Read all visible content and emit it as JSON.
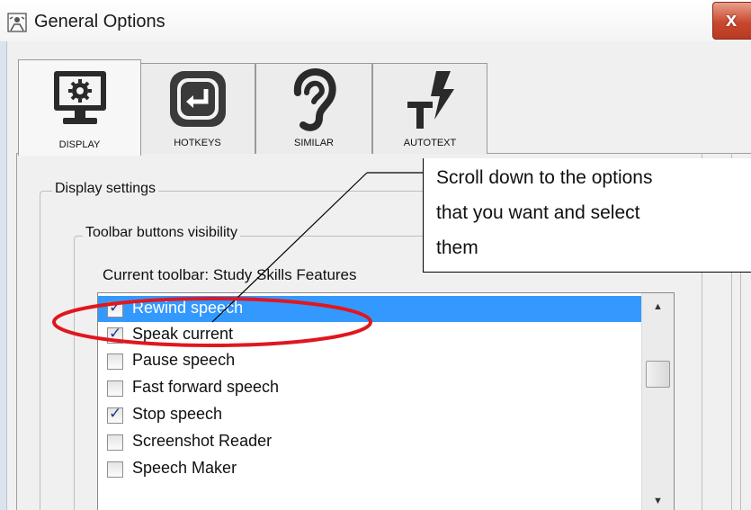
{
  "window": {
    "title": "General Options",
    "close_label": "x"
  },
  "tabs": [
    {
      "label": "DISPLAY",
      "icon": "monitor-gear-icon",
      "active": true
    },
    {
      "label": "HOTKEYS",
      "icon": "enter-key-icon",
      "active": false
    },
    {
      "label": "SIMILAR",
      "icon": "ear-icon",
      "active": false
    },
    {
      "label": "AUTOTEXT",
      "icon": "text-lightning-icon",
      "active": false
    }
  ],
  "display_settings": {
    "legend": "Display settings",
    "toolbar_group": {
      "legend": "Toolbar buttons visibility",
      "current_toolbar": "Current toolbar: Study Skills Features",
      "items": [
        {
          "label": "Rewind speech",
          "checked": true,
          "selected": true
        },
        {
          "label": "Speak current",
          "checked": true,
          "selected": false
        },
        {
          "label": "Pause speech",
          "checked": false,
          "selected": false
        },
        {
          "label": "Fast forward speech",
          "checked": false,
          "selected": false
        },
        {
          "label": "Stop speech",
          "checked": true,
          "selected": false
        },
        {
          "label": "Screenshot Reader",
          "checked": false,
          "selected": false
        },
        {
          "label": "Speech Maker",
          "checked": false,
          "selected": false
        }
      ]
    }
  },
  "callout": {
    "lines": [
      "Scroll down to the options",
      "that you want and select",
      "them"
    ]
  },
  "colors": {
    "selection": "#3399ff",
    "annotation_ellipse": "#e0171e",
    "close_button": "#c9492f"
  }
}
